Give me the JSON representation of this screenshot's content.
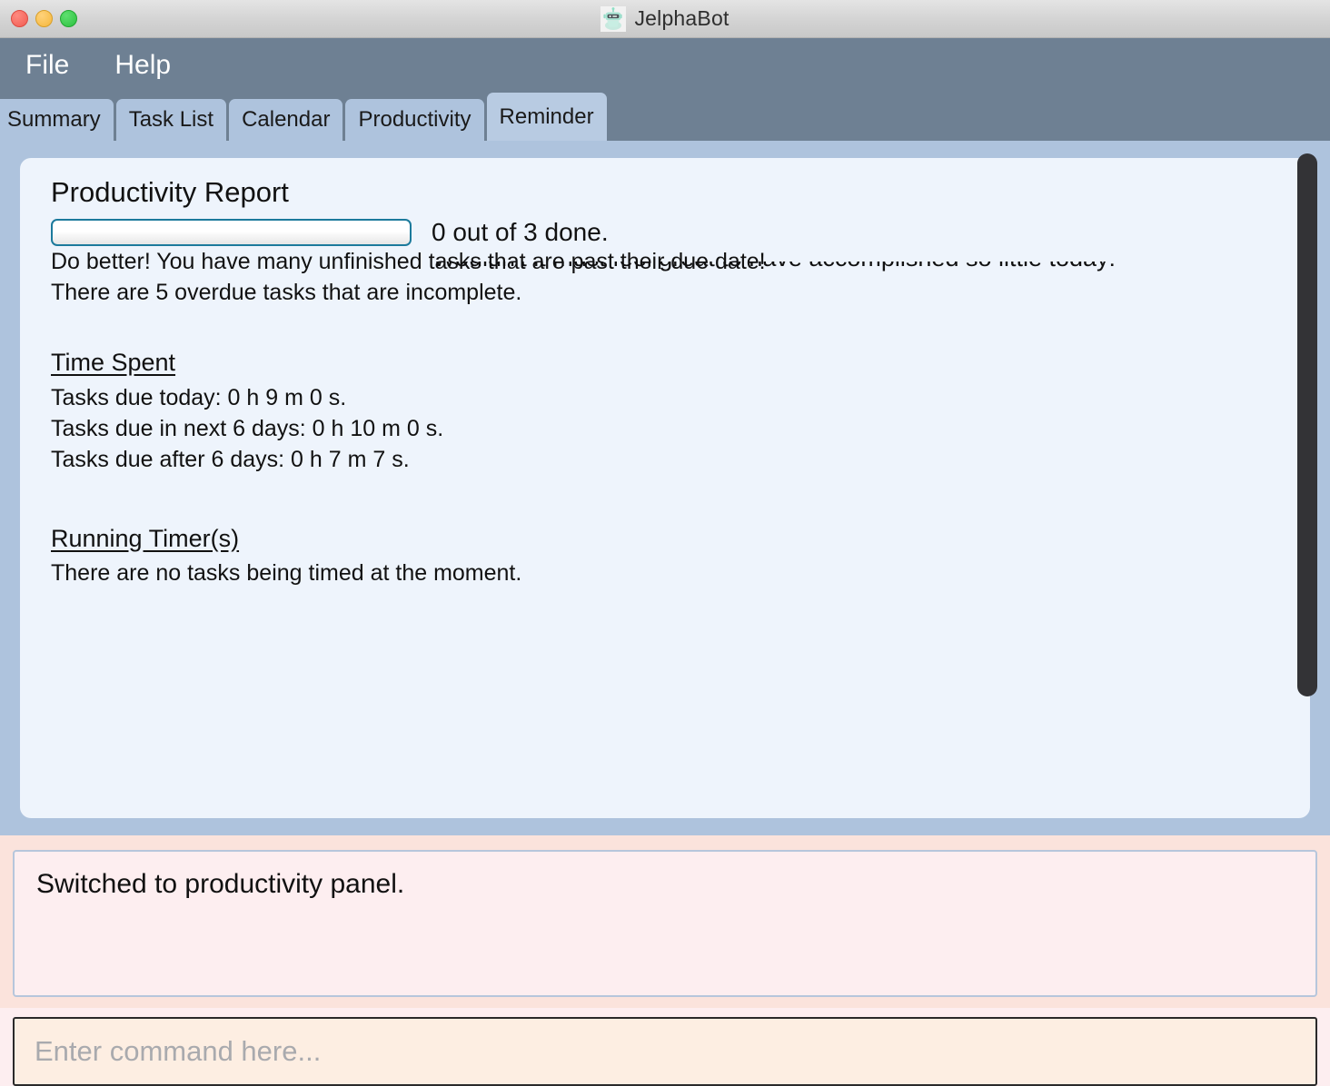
{
  "window": {
    "title": "JelphaBot",
    "app_icon": "robot-icon",
    "controls": {
      "close_label": "close",
      "minimize_label": "minimize",
      "zoom_label": "zoom"
    }
  },
  "menubar": {
    "items": [
      {
        "label": "File"
      },
      {
        "label": "Help"
      }
    ]
  },
  "tabs": [
    {
      "label": "Summary",
      "selected": false
    },
    {
      "label": "Task List",
      "selected": false
    },
    {
      "label": "Calendar",
      "selected": false
    },
    {
      "label": "Productivity",
      "selected": false
    },
    {
      "label": "Reminder",
      "selected": true
    }
  ],
  "report": {
    "title": "Productivity Report",
    "progress": {
      "percent": 0,
      "done": 0,
      "total": 3,
      "label": "0 out of 3 done."
    },
    "encouragement_clipped": "Wouldn't it must feel great to have accomplished so little today!",
    "status_lines": [
      "Do better! You have many unfinished tasks that are past their due date!",
      "There are 5 overdue tasks that are incomplete."
    ],
    "time_spent": {
      "heading": "Time Spent",
      "lines": [
        "Tasks due today: 0 h 9 m 0 s.",
        "Tasks due in next 6 days: 0 h 10 m 0 s.",
        "Tasks due after 6 days: 0 h 7 m 7 s."
      ]
    },
    "running_timers": {
      "heading": "Running Timer(s)",
      "lines": [
        "There are no tasks being timed at the moment."
      ]
    }
  },
  "result_display": {
    "message": "Switched to productivity panel."
  },
  "command_input": {
    "value": "",
    "placeholder": "Enter command here..."
  },
  "colors": {
    "window_background": "#aec3dd",
    "menubar": "#6e8093",
    "panel_background": "#eef4fc",
    "tab_background": "#aec3dd",
    "tab_selected": "#b8cbe2",
    "progress_border": "#1c7a9c",
    "result_region": "#fbe3dc",
    "result_box": "#fdeef0",
    "command_box": "#fdeee2",
    "scrollbar_thumb": "#333336"
  }
}
